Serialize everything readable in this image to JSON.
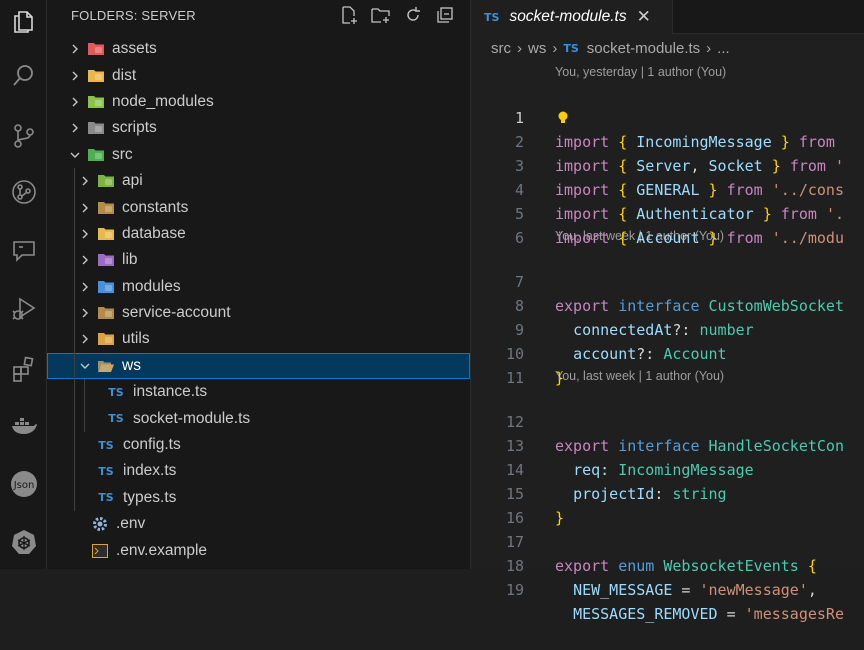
{
  "sidebar": {
    "title": "FOLDERS: SERVER",
    "tree": [
      {
        "label": "assets",
        "depth": 0,
        "chevron": "right",
        "icon": "folder-assets-icon",
        "color": "#e05a5a"
      },
      {
        "label": "dist",
        "depth": 0,
        "chevron": "right",
        "icon": "folder-dist-icon",
        "color": "#e8b94a"
      },
      {
        "label": "node_modules",
        "depth": 0,
        "chevron": "right",
        "icon": "folder-node-icon",
        "color": "#8bc34a"
      },
      {
        "label": "scripts",
        "depth": 0,
        "chevron": "right",
        "icon": "folder-scripts-icon",
        "color": "#8a8a8a"
      },
      {
        "label": "src",
        "depth": 0,
        "chevron": "down",
        "icon": "folder-src-icon",
        "color": "#4caf50"
      },
      {
        "label": "api",
        "depth": 1,
        "chevron": "right",
        "icon": "folder-api-icon",
        "color": "#7cb342"
      },
      {
        "label": "constants",
        "depth": 1,
        "chevron": "right",
        "icon": "folder-constants-icon",
        "color": "#b58b4a"
      },
      {
        "label": "database",
        "depth": 1,
        "chevron": "right",
        "icon": "folder-database-icon",
        "color": "#e8b94a"
      },
      {
        "label": "lib",
        "depth": 1,
        "chevron": "right",
        "icon": "folder-lib-icon",
        "color": "#9c6bc4"
      },
      {
        "label": "modules",
        "depth": 1,
        "chevron": "right",
        "icon": "folder-modules-icon",
        "color": "#4a90d9"
      },
      {
        "label": "service-account",
        "depth": 1,
        "chevron": "right",
        "icon": "folder-icon",
        "color": "#b58b4a"
      },
      {
        "label": "utils",
        "depth": 1,
        "chevron": "right",
        "icon": "folder-utils-icon",
        "color": "#d9a441"
      },
      {
        "label": "ws",
        "depth": 1,
        "chevron": "down",
        "icon": "folder-open-icon",
        "color": "#c9a86b",
        "selected": true
      },
      {
        "label": "instance.ts",
        "depth": 2,
        "chevron": "none",
        "icon": "ts-file-icon"
      },
      {
        "label": "socket-module.ts",
        "depth": 2,
        "chevron": "none",
        "icon": "ts-file-icon"
      },
      {
        "label": "config.ts",
        "depth": 1,
        "chevron": "none",
        "icon": "ts-file-icon"
      },
      {
        "label": "index.ts",
        "depth": 1,
        "chevron": "none",
        "icon": "ts-file-icon"
      },
      {
        "label": "types.ts",
        "depth": 1,
        "chevron": "none",
        "icon": "ts-file-icon"
      },
      {
        "label": ".env",
        "depth": 0,
        "chevron": "none",
        "icon": "gear-file-icon"
      },
      {
        "label": ".env.example",
        "depth": 0,
        "chevron": "none",
        "icon": "terminal-file-icon"
      }
    ]
  },
  "editor": {
    "tab": {
      "badge": "TS",
      "name": "socket-module.ts",
      "close": "✕"
    },
    "breadcrumb": {
      "part1": "src",
      "part2": "ws",
      "badge": "TS",
      "file": "socket-module.ts",
      "ellipsis": "..."
    },
    "lens1": "You, yesterday | 1 author (You)",
    "lens2": "You, last week | 1 author (You)",
    "lens3": "You, last week | 1 author (You)",
    "lines": {
      "n1": "1",
      "n2": "2",
      "n3": "3",
      "n4": "4",
      "n5": "5",
      "n6": "6",
      "n7": "7",
      "n8": "8",
      "n9": "9",
      "n10": "10",
      "n11": "11",
      "n12": "12",
      "n13": "13",
      "n14": "14",
      "n15": "15",
      "n16": "16",
      "n17": "17",
      "n18": "18",
      "n19": "19",
      "l1_imp": "IncomingMessage",
      "l1_from": "from",
      "l2_a": "Server",
      "l2_b": "Socket",
      "l2_from": "from '",
      "l3_a": "GENERAL",
      "l3_from": "from",
      "l3_str": "'../cons",
      "l4_a": "Authenticator",
      "l4_from": "from",
      "l4_str": "'.",
      "l5_a": "Account",
      "l5_from": "from",
      "l5_str": "'../modu",
      "l7_name": "CustomWebSocket",
      "l8_prop": "connectedAt",
      "l8_type": "number",
      "l9_prop": "account",
      "l9_type": "Account",
      "l12_name": "HandleSocketCon",
      "l13_prop": "req",
      "l13_type": "IncomingMessage",
      "l14_prop": "projectId",
      "l14_type": "string",
      "l17_name": "WebsocketEvents",
      "l18_prop": "NEW_MESSAGE",
      "l18_str": "'newMessage'",
      "l19_prop": "MESSAGES_REMOVED",
      "l19_str": "'messagesRe"
    }
  }
}
